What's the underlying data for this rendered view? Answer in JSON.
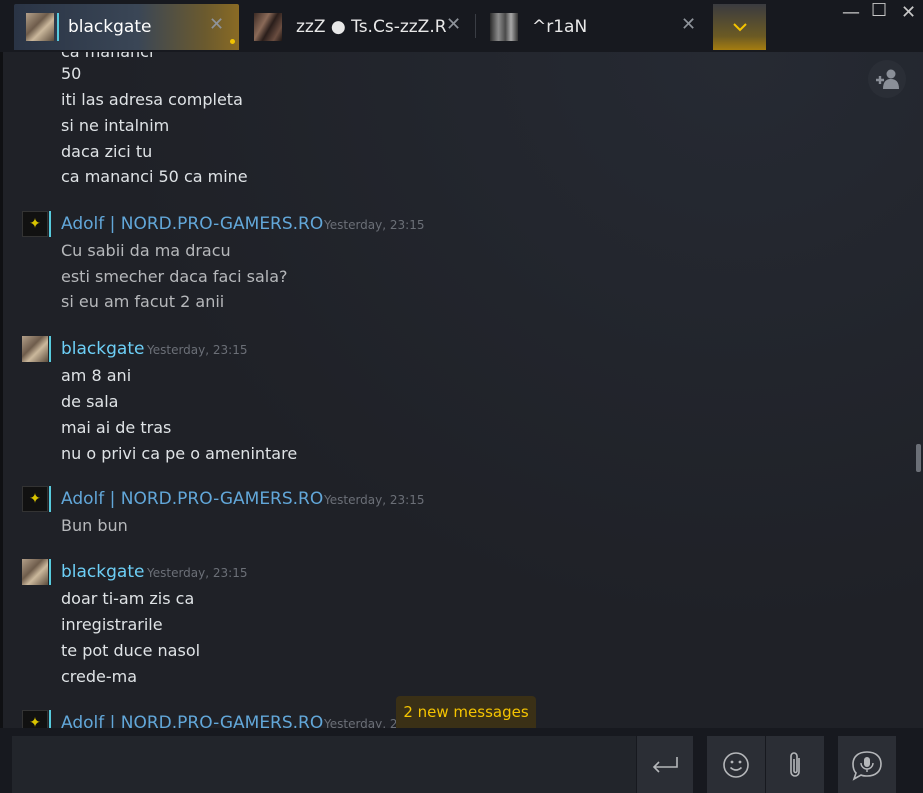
{
  "tabs": [
    {
      "label": "blackgate",
      "active": true
    },
    {
      "label": "zzZ ● Ts.Cs-zzZ.Ro",
      "active": false
    },
    {
      "label": "^r1aN",
      "active": false
    }
  ],
  "tab_close_glyph": "✕",
  "more_tabs_icon": "chevron-down-icon",
  "window_controls": {
    "minimize": "—",
    "maximize": "☐",
    "close": "✕"
  },
  "messages": {
    "cont_lines": [
      "50",
      "iti las adresa completa",
      "si ne intalnim",
      "daca zici tu",
      "ca mananci 50 ca mine"
    ],
    "g1": {
      "sender": "Adolf | NORD.PRO-GAMERS.RO",
      "time": "Yesterday, 23:15",
      "lines": [
        "Cu sabii da ma dracu",
        "esti smecher daca faci sala?",
        "si eu am facut 2 anii"
      ]
    },
    "g2": {
      "sender": "blackgate",
      "time": "Yesterday, 23:15",
      "lines": [
        "am 8 ani",
        "de sala",
        "mai ai de tras",
        "nu o privi ca pe o amenintare"
      ]
    },
    "g3": {
      "sender": "Adolf | NORD.PRO-GAMERS.RO",
      "time": "Yesterday, 23:15",
      "lines": [
        "Bun bun"
      ]
    },
    "g4": {
      "sender": "blackgate",
      "time": "Yesterday, 23:15",
      "lines": [
        "doar ti-am zis ca",
        "inregistrarile",
        "te pot duce nasol",
        "crede-ma"
      ]
    },
    "g5": {
      "sender": "Adolf | NORD.PRO-GAMERS.RO",
      "time": "Yesterday, 2"
    }
  },
  "new_messages_label": "2 new messages",
  "composer": {
    "placeholder": ""
  },
  "colors": {
    "accent": "#57cbde",
    "unread": "#f5c400",
    "sender_friend": "#62a7d9",
    "sender_self": "#6dcff6"
  }
}
